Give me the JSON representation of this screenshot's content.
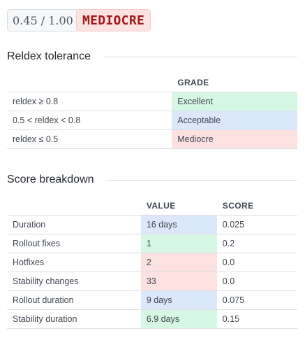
{
  "header": {
    "score_text": "0.45 / 1.00",
    "grade_label": "MEDIOCRE"
  },
  "tolerance": {
    "title": "Reldex tolerance",
    "columns": [
      "",
      "GRADE"
    ],
    "rows": [
      {
        "condition": "reldex ≥ 0.8",
        "grade": "Excellent",
        "color": "green"
      },
      {
        "condition": "0.5 < reldex < 0.8",
        "grade": "Acceptable",
        "color": "blue"
      },
      {
        "condition": "reldex ≤ 0.5",
        "grade": "Mediocre",
        "color": "red"
      }
    ]
  },
  "breakdown": {
    "title": "Score breakdown",
    "columns": [
      "",
      "VALUE",
      "SCORE"
    ],
    "rows": [
      {
        "metric": "Duration",
        "value": "16 days",
        "score": "0.025",
        "color": "blue"
      },
      {
        "metric": "Rollout fixes",
        "value": "1",
        "score": "0.2",
        "color": "green"
      },
      {
        "metric": "Hotfixes",
        "value": "2",
        "score": "0.0",
        "color": "red"
      },
      {
        "metric": "Stability changes",
        "value": "33",
        "score": "0.0",
        "color": "red"
      },
      {
        "metric": "Rollout duration",
        "value": "9 days",
        "score": "0.075",
        "color": "blue"
      },
      {
        "metric": "Stability duration",
        "value": "6.9 days",
        "score": "0.15",
        "color": "green"
      }
    ]
  },
  "colors": {
    "green": "#d6f7e3",
    "blue": "#dbe8fb",
    "red": "#fde1e1",
    "grade_badge_bg": "#fde2e2",
    "grade_badge_text": "#a11a1a"
  }
}
